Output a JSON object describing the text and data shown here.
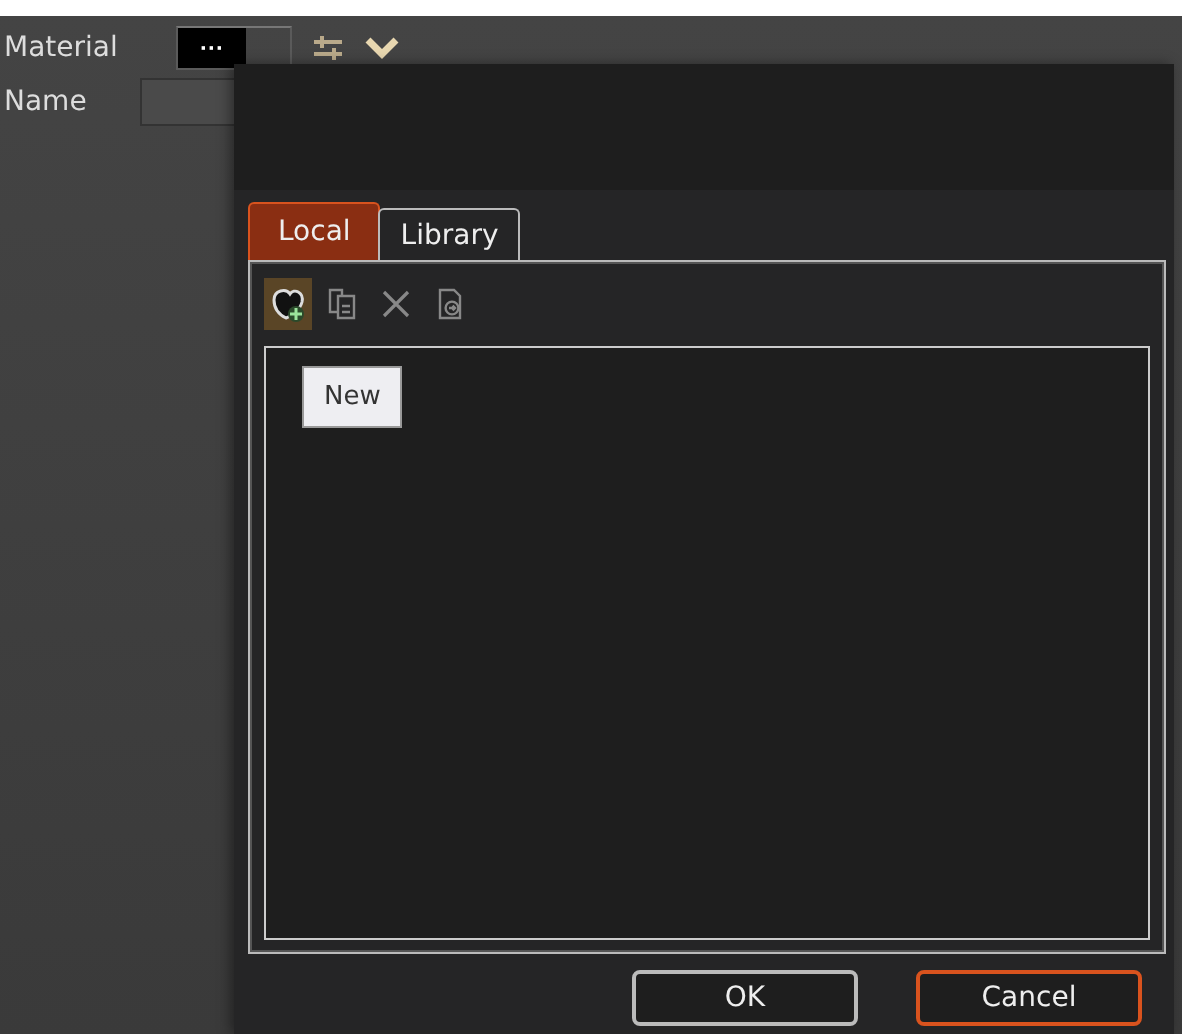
{
  "form": {
    "material_label": "Material",
    "material_button": "···",
    "name_label": "Name"
  },
  "dialog": {
    "tabs": [
      {
        "label": "Local",
        "selected": true
      },
      {
        "label": "Library",
        "selected": false
      }
    ],
    "toolbar": [
      {
        "kind": "new",
        "highlighted": true
      },
      {
        "kind": "copy",
        "highlighted": false
      },
      {
        "kind": "delete",
        "highlighted": false
      },
      {
        "kind": "import",
        "highlighted": false
      }
    ],
    "tooltip": "New",
    "buttons": [
      {
        "label": "OK",
        "focused": false
      },
      {
        "label": "Cancel",
        "focused": true
      }
    ]
  }
}
